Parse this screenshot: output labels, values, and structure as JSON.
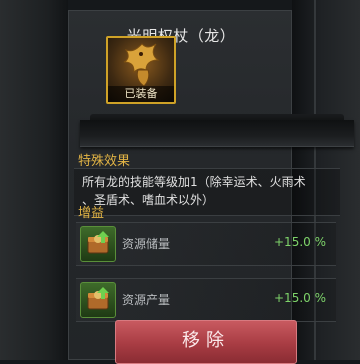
{
  "item": {
    "title": "光明权杖（龙）",
    "equipped_label": "已装备",
    "icon": "dragon-icon"
  },
  "special_effect": {
    "heading": "特殊效果",
    "line1": "所有龙的技能等级加1（除幸运术、火雨术",
    "line2": "、圣盾术、嗜血术以外）"
  },
  "gain": {
    "heading": "增益",
    "rows": [
      {
        "name": "资源储量",
        "value": "+15.0 %",
        "icon": "resource-storage-icon"
      },
      {
        "name": "资源产量",
        "value": "+15.0 %",
        "icon": "resource-production-icon"
      }
    ]
  },
  "actions": {
    "remove_label": "移除"
  },
  "colors": {
    "accent_gold": "#e2b445",
    "buff_green": "#7ed36a",
    "button_red": "#b0424a"
  }
}
